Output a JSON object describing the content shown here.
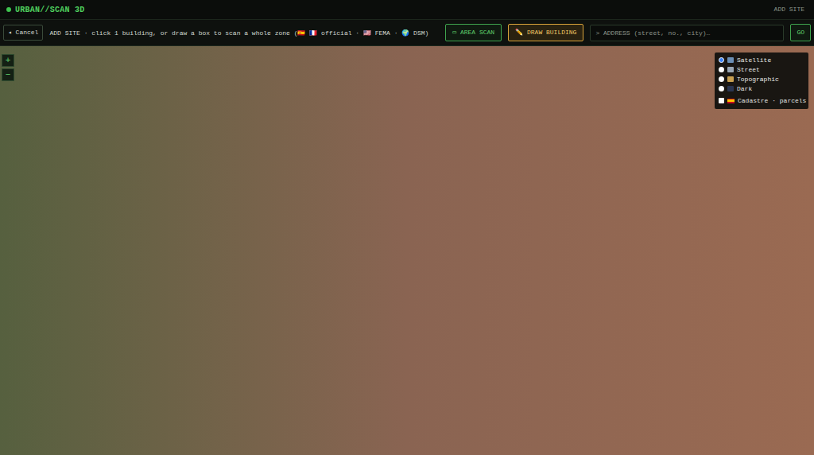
{
  "app": {
    "title": "URBAN//SCAN 3D",
    "header_action": "ADD SITE"
  },
  "toolbar": {
    "cancel": "◂ Cancel",
    "hint": "ADD SITE · click 1 building, or draw a box to scan a whole zone (🇪🇸 🇫🇷 official · 🇺🇸 FEMA · 🌍 DSM)",
    "modes": [
      {
        "label": "▭ AREA SCAN",
        "selected": false
      },
      {
        "label": "✏️ DRAW BUILDING",
        "selected": true
      }
    ],
    "address": {
      "placeholder": "> ADDRESS (street, no., city)…"
    },
    "go": "GO"
  },
  "map": {
    "zoom": [
      "+",
      "−"
    ],
    "layers": [
      {
        "label": "Satellite",
        "selected": true
      },
      {
        "label": "Street",
        "selected": false
      },
      {
        "label": "Topographic",
        "selected": false
      },
      {
        "label": "Dark",
        "selected": false
      }
    ],
    "overlays": [
      {
        "label": "Cadastre · parcels",
        "checked": false
      }
    ]
  }
}
